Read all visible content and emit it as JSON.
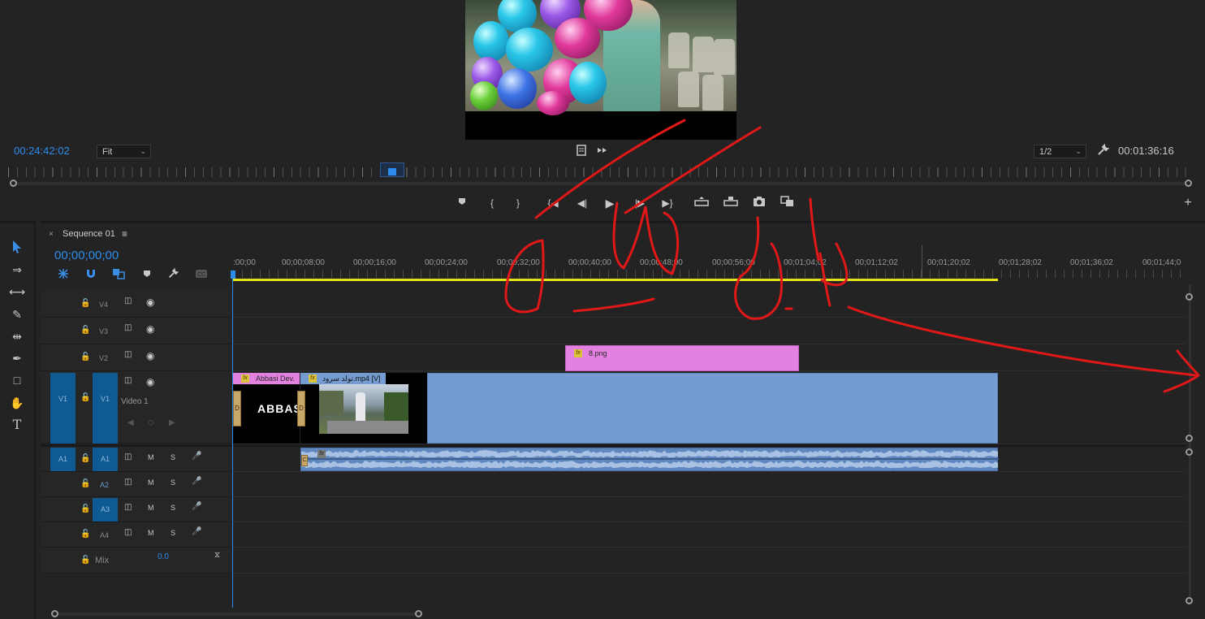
{
  "monitor": {
    "timecode_left": "00:24:42:02",
    "zoom_select": "Fit",
    "resolution_select": "1/2",
    "timecode_right": "00:01:36:16",
    "transport": [
      "marker-icon",
      "mark-in-icon",
      "mark-out-icon",
      "go-to-in-icon",
      "step-back-icon",
      "play-icon",
      "step-forward-icon",
      "go-to-out-icon",
      "lift-icon",
      "extract-icon",
      "export-frame-icon",
      "compare-icon"
    ]
  },
  "sequence": {
    "close_glyph": "×",
    "tab_label": "Sequence 01",
    "menu_glyph": "≡",
    "timecode": "00;00;00;00",
    "ruler_labels": [
      ":00;00",
      "00;00;08;00",
      "00;00;16;00",
      "00;00;24;00",
      "00;00;32;00",
      "00;00;40;00",
      "00;00;48;00",
      "00;00;56;00",
      "00;01;04;02",
      "00;01;12;02",
      "00;01;20;02",
      "00;01;28;02",
      "00;01;36;02",
      "00;01;44;0"
    ]
  },
  "tracks": {
    "video": [
      {
        "id": "V4",
        "label": "V4"
      },
      {
        "id": "V3",
        "label": "V3"
      },
      {
        "id": "V2",
        "label": "V2"
      },
      {
        "id": "V1",
        "label": "V1",
        "source": "V1",
        "name": "Video 1"
      }
    ],
    "audio": [
      {
        "id": "A1",
        "label": "A1",
        "source": "A1"
      },
      {
        "id": "A2",
        "label": "A2"
      },
      {
        "id": "A3",
        "label": "A3"
      },
      {
        "id": "A4",
        "label": "A4"
      }
    ],
    "mute_label": "M",
    "solo_label": "S",
    "mix_label": "Mix",
    "mix_value": "0.0"
  },
  "clips": {
    "v2_png": "8.png",
    "v1_title": "Abbasi Dev.",
    "v1_title_text": "ABBAS",
    "v1_mp4": "تولد سرود.mp4 [V]",
    "fx": "fx",
    "transition_letter": "D",
    "audio_transition_letter": "C",
    "audio_fx": "fx"
  },
  "colors": {
    "accent": "#2d8ceb",
    "track_target": "#0f5a92",
    "clip_pink": "#e381e0",
    "clip_blue": "#749cd0",
    "work_area": "#e6e21a",
    "annotation": "#e01818"
  }
}
